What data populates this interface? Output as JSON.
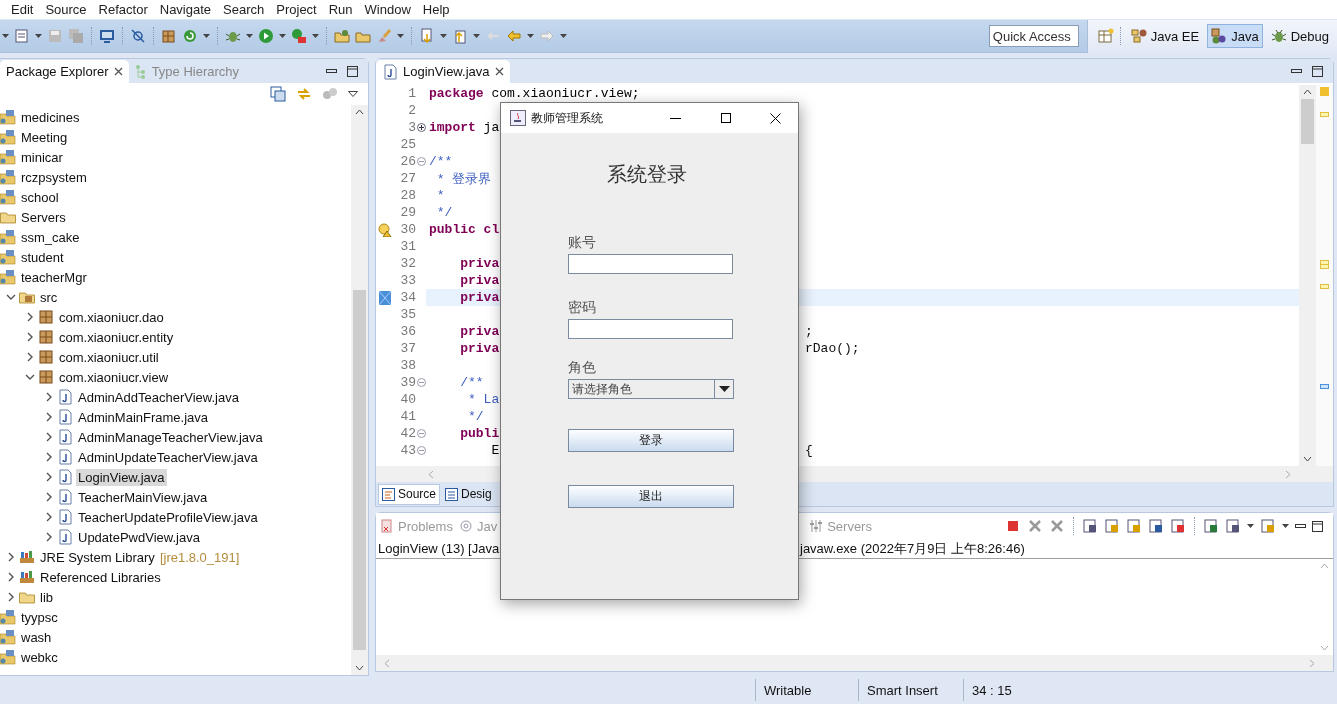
{
  "menu": [
    "Edit",
    "Source",
    "Refactor",
    "Navigate",
    "Search",
    "Project",
    "Run",
    "Window",
    "Help"
  ],
  "toolbar": {
    "quick_access": {
      "placeholder": "Quick Access"
    },
    "perspectives": [
      {
        "label": "Java EE",
        "kind": "javaee",
        "selected": false
      },
      {
        "label": "Java",
        "kind": "java",
        "selected": true
      },
      {
        "label": "Debug",
        "kind": "debug",
        "selected": false
      }
    ]
  },
  "explorer": {
    "tabs": [
      {
        "label": "Package Explorer",
        "selected": true
      },
      {
        "label": "Type Hierarchy",
        "selected": false
      }
    ],
    "tree": [
      {
        "label": "medicines",
        "kind": "project"
      },
      {
        "label": "Meeting",
        "kind": "project"
      },
      {
        "label": "minicar",
        "kind": "project"
      },
      {
        "label": "rczpsystem",
        "kind": "project"
      },
      {
        "label": "school",
        "kind": "project"
      },
      {
        "label": "Servers",
        "kind": "folder"
      },
      {
        "label": "ssm_cake",
        "kind": "project"
      },
      {
        "label": "student",
        "kind": "project"
      },
      {
        "label": "teacherMgr",
        "kind": "project",
        "children": [
          {
            "label": "src",
            "kind": "source",
            "expanded": true,
            "children": [
              {
                "label": "com.xiaoniucr.dao",
                "kind": "package",
                "expanded": false
              },
              {
                "label": "com.xiaoniucr.entity",
                "kind": "package",
                "expanded": false
              },
              {
                "label": "com.xiaoniucr.util",
                "kind": "package",
                "expanded": false
              },
              {
                "label": "com.xiaoniucr.view",
                "kind": "package",
                "expanded": true,
                "children": [
                  {
                    "label": "AdminAddTeacherView.java",
                    "kind": "java",
                    "expanded": false,
                    "selected": false
                  },
                  {
                    "label": "AdminMainFrame.java",
                    "kind": "java",
                    "expanded": false,
                    "selected": false
                  },
                  {
                    "label": "AdminManageTeacherView.java",
                    "kind": "java",
                    "expanded": false,
                    "selected": false
                  },
                  {
                    "label": "AdminUpdateTeacherView.java",
                    "kind": "java",
                    "expanded": false,
                    "selected": false
                  },
                  {
                    "label": "LoginView.java",
                    "kind": "java",
                    "expanded": false,
                    "selected": true
                  },
                  {
                    "label": "TeacherMainView.java",
                    "kind": "java",
                    "expanded": false,
                    "selected": false
                  },
                  {
                    "label": "TeacherUpdateProfileView.java",
                    "kind": "java",
                    "expanded": false,
                    "selected": false
                  },
                  {
                    "label": "UpdatePwdView.java",
                    "kind": "java",
                    "expanded": false,
                    "selected": false
                  }
                ]
              }
            ]
          },
          {
            "label": "JRE System Library",
            "decoration": "[jre1.8.0_191]",
            "kind": "library",
            "expanded": false
          },
          {
            "label": "Referenced Libraries",
            "kind": "library",
            "expanded": false
          },
          {
            "label": "lib",
            "kind": "folder",
            "expanded": false
          }
        ]
      },
      {
        "label": "tyypsc",
        "kind": "project"
      },
      {
        "label": "wash",
        "kind": "project"
      },
      {
        "label": "webkc",
        "kind": "project"
      }
    ]
  },
  "editor": {
    "tabs": [
      {
        "label": "LoginView.java",
        "selected": true
      }
    ],
    "lines": [
      {
        "number": "1",
        "segments": [
          {
            "text": "package",
            "kind": "keyword"
          },
          {
            "text": " com.xiaoniucr.view;",
            "kind": "plain"
          }
        ]
      },
      {
        "number": "2"
      },
      {
        "number": "3",
        "folded": true,
        "segments": [
          {
            "text": "import",
            "kind": "keyword"
          },
          {
            "text": " ja",
            "kind": "plain"
          }
        ]
      },
      {
        "number": "25"
      },
      {
        "number": "26",
        "folded": false,
        "segments": [
          {
            "text": "/**",
            "kind": "comment"
          }
        ]
      },
      {
        "number": "27",
        "segments": [
          {
            "text": " * ",
            "kind": "comment"
          },
          {
            "text": "登录界",
            "kind": "doc"
          }
        ]
      },
      {
        "number": "28",
        "segments": [
          {
            "text": " *",
            "kind": "comment"
          }
        ]
      },
      {
        "number": "29",
        "segments": [
          {
            "text": " */",
            "kind": "comment"
          }
        ]
      },
      {
        "number": "30",
        "warning": true,
        "segments": [
          {
            "text": "public",
            "kind": "keyword"
          },
          {
            "text": " cl",
            "kind": "keyword"
          }
        ]
      },
      {
        "number": "31"
      },
      {
        "number": "32",
        "segments": [
          {
            "text": "    priva",
            "kind": "keyword"
          }
        ]
      },
      {
        "number": "33",
        "segments": [
          {
            "text": "    priva",
            "kind": "keyword"
          }
        ]
      },
      {
        "number": "34",
        "current": true,
        "segments": [
          {
            "text": "    priva",
            "kind": "keyword"
          }
        ]
      },
      {
        "number": "35"
      },
      {
        "number": "36",
        "segments": [
          {
            "text": "    priva",
            "kind": "keyword"
          }
        ],
        "right": ";"
      },
      {
        "number": "37",
        "segments": [
          {
            "text": "    priva",
            "kind": "keyword"
          }
        ],
        "right": "rDao();"
      },
      {
        "number": "38"
      },
      {
        "number": "39",
        "folded": false,
        "segments": [
          {
            "text": "    /**",
            "kind": "comment"
          }
        ]
      },
      {
        "number": "40",
        "segments": [
          {
            "text": "     * La",
            "kind": "comment"
          }
        ]
      },
      {
        "number": "41",
        "segments": [
          {
            "text": "     */",
            "kind": "comment"
          }
        ]
      },
      {
        "number": "42",
        "folded": false,
        "segments": [
          {
            "text": "    publi",
            "kind": "keyword"
          }
        ]
      },
      {
        "number": "43",
        "folded": false,
        "segments": [
          {
            "text": "        E",
            "kind": "plain"
          }
        ],
        "right": "{"
      }
    ],
    "bottom_tabs": [
      {
        "label": "Source",
        "kind": "source",
        "selected": true
      },
      {
        "label": "Desig",
        "kind": "design",
        "selected": false
      }
    ]
  },
  "console": {
    "tabs": [
      {
        "label": "Problems",
        "kind": "problems"
      },
      {
        "label": "Jav",
        "kind": "javadoc"
      },
      {
        "label": "Servers",
        "kind": "servers"
      }
    ],
    "header_left": "LoginView (13) [Java",
    "header_right": "javaw.exe (2022年7月9日 上午8:26:46)"
  },
  "status_bar": [
    "Writable",
    "Smart Insert",
    "34 : 15"
  ],
  "dialog": {
    "title": "教师管理系统",
    "heading": "系统登录",
    "fields": [
      {
        "label": "账号",
        "kind": "text"
      },
      {
        "label": "密码",
        "kind": "password"
      },
      {
        "label": "角色",
        "kind": "select",
        "value": "请选择角色"
      }
    ],
    "buttons": [
      "登录",
      "退出"
    ]
  }
}
